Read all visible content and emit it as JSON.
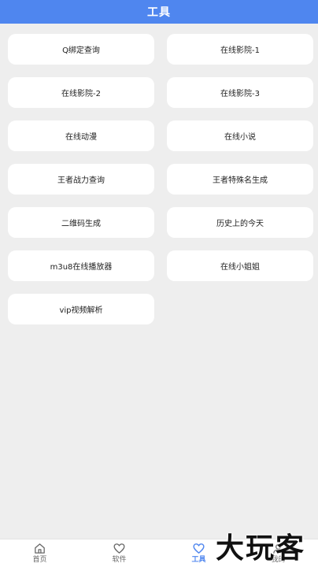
{
  "header": {
    "title": "工具"
  },
  "tools": [
    "Q绑定查询",
    "在线影院-1",
    "在线影院-2",
    "在线影院-3",
    "在线动漫",
    "在线小说",
    "王者战力查询",
    "王者特殊名生成",
    "二维码生成",
    "历史上的今天",
    "m3u8在线播放器",
    "在线小姐姐",
    "vip视频解析"
  ],
  "tabbar": {
    "items": [
      {
        "label": "首页",
        "icon": "home-icon"
      },
      {
        "label": "软件",
        "icon": "heart-icon"
      },
      {
        "label": "工具",
        "icon": "heart-icon",
        "active": true
      },
      {
        "label": "我的",
        "icon": "user-icon"
      }
    ],
    "active_color": "#4f86ef"
  },
  "watermark": {
    "text": "大玩客"
  }
}
